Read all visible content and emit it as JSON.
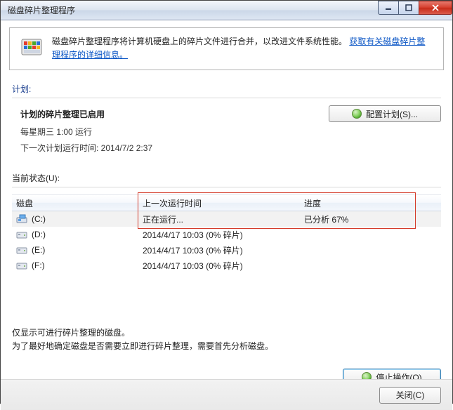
{
  "window": {
    "title": "磁盘碎片整理程序"
  },
  "banner": {
    "text_before_link": "磁盘碎片整理程序将计算机硬盘上的碎片文件进行合并，以改进文件系统性能。",
    "link": "获取有关磁盘碎片整理程序的详细信息。"
  },
  "sections": {
    "schedule_label": "计划:",
    "status_label": "当前状态(U):"
  },
  "schedule": {
    "heading": "计划的碎片整理已启用",
    "line1": "每星期三  1:00 运行",
    "line2": "下一次计划运行时间: 2014/7/2 2:37",
    "configure_btn": "配置计划(S)..."
  },
  "table": {
    "columns": {
      "disk": "磁盘",
      "last": "上一次运行时间",
      "progress": "进度"
    },
    "rows": [
      {
        "drive": "(C:)",
        "type": "os",
        "last": "正在运行...",
        "progress": "已分析 67%",
        "selected": true
      },
      {
        "drive": "(D:)",
        "type": "hdd",
        "last": "2014/4/17 10:03 (0% 碎片)",
        "progress": "",
        "selected": false
      },
      {
        "drive": "(E:)",
        "type": "hdd",
        "last": "2014/4/17 10:03 (0% 碎片)",
        "progress": "",
        "selected": false
      },
      {
        "drive": "(F:)",
        "type": "hdd",
        "last": "2014/4/17 10:03 (0% 碎片)",
        "progress": "",
        "selected": false
      }
    ]
  },
  "notes": {
    "line1": "仅显示可进行碎片整理的磁盘。",
    "line2": "为了最好地确定磁盘是否需要立即进行碎片整理，需要首先分析磁盘。"
  },
  "buttons": {
    "stop": "停止操作(O)",
    "close": "关闭(C)"
  }
}
